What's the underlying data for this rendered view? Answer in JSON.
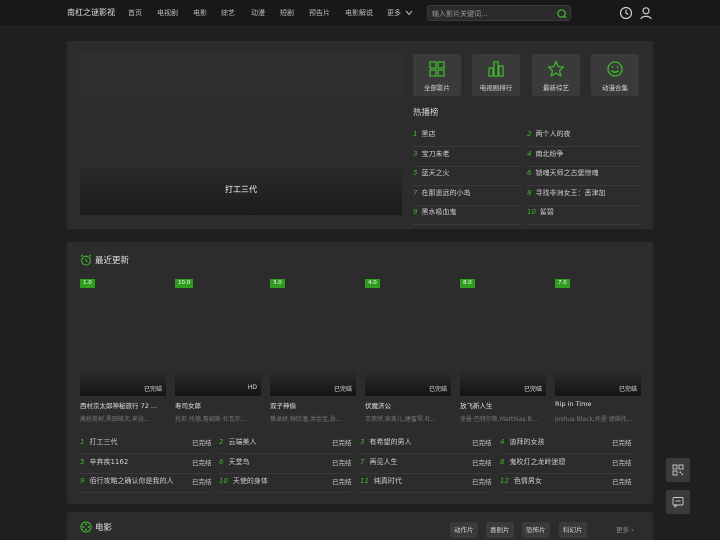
{
  "header": {
    "logo": "南杠之谜影视",
    "nav": [
      "首页",
      "电视剧",
      "电影",
      "综艺",
      "动漫",
      "短剧",
      "预告片",
      "电影解说",
      "更多"
    ],
    "search_placeholder": "输入影片关键词...",
    "icons": [
      "history-icon",
      "user-icon"
    ]
  },
  "hero": {
    "title": "打工三代",
    "categories": [
      {
        "label": "全部影片",
        "icon": "grid-icon"
      },
      {
        "label": "电视剧排行",
        "icon": "bar-chart-icon"
      },
      {
        "label": "最新综艺",
        "icon": "star-icon"
      },
      {
        "label": "动漫合集",
        "icon": "smile-icon"
      }
    ],
    "hot_title": "热播榜",
    "hot_list": [
      {
        "num": "1",
        "title": "黑店"
      },
      {
        "num": "2",
        "title": "两个人的夜"
      },
      {
        "num": "3",
        "title": "宝刀未老"
      },
      {
        "num": "4",
        "title": "南北纷争"
      },
      {
        "num": "5",
        "title": "蓝天之火"
      },
      {
        "num": "6",
        "title": "锁魂天师之古堡惊魂"
      },
      {
        "num": "7",
        "title": "在那遥远的小岛"
      },
      {
        "num": "8",
        "title": "寻找非洲女王：恶津加"
      },
      {
        "num": "9",
        "title": "黑水吸血鬼"
      },
      {
        "num": "10",
        "title": "鲨碧"
      }
    ]
  },
  "recent": {
    "title": "最近更新",
    "cards": [
      {
        "score": "1.0",
        "status": "已完结",
        "name": "西村京太郎神秘旅行 72 ...",
        "cast": "高桥英树,黑田绫次,来谷..."
      },
      {
        "score": "10.0",
        "status": "HD",
        "name": "寿司女郎",
        "cast": "托尼·托德,詹姆斯·杜瓦尔..."
      },
      {
        "score": "3.0",
        "status": "已完结",
        "name": "双子神偷",
        "cast": "蔡卓妍,钟欣潼,洪金宝,张..."
      },
      {
        "score": "4.0",
        "status": "已完结",
        "name": "伏魔济公",
        "cast": "王荣然,宋美儿,唐蜜琴,杜..."
      },
      {
        "score": "8.0",
        "status": "已完结",
        "name": "放飞新人生",
        "cast": "菲曼·巴特尔斯,Matthias B..."
      },
      {
        "score": "7.0",
        "status": "已完结",
        "name": "Rip in Time",
        "cast": "Joshua Black,托里·德维托..."
      }
    ],
    "list": [
      {
        "num": "1",
        "title": "打工三代",
        "status": "已完结"
      },
      {
        "num": "2",
        "title": "云端美人",
        "status": "已完结"
      },
      {
        "num": "3",
        "title": "有希望的男人",
        "status": "已完结"
      },
      {
        "num": "4",
        "title": "迪拜的女孩",
        "status": "已完结"
      },
      {
        "num": "5",
        "title": "辛弃疾1162",
        "status": "已完结"
      },
      {
        "num": "6",
        "title": "天堂鸟",
        "status": "已完结"
      },
      {
        "num": "7",
        "title": "再见人生",
        "status": "已完结"
      },
      {
        "num": "8",
        "title": "鬼吹灯之龙岭迷窟",
        "status": "已完结"
      },
      {
        "num": "9",
        "title": "佰行攻略之确认你是我的人",
        "status": "已完结"
      },
      {
        "num": "10",
        "title": "天使的身体",
        "status": "已完结"
      },
      {
        "num": "11",
        "title": "纯真时代",
        "status": "已完结"
      },
      {
        "num": "12",
        "title": "色情男女",
        "status": "已完结"
      }
    ]
  },
  "movies": {
    "title": "电影",
    "tags": [
      "动作片",
      "喜剧片",
      "恐怖片",
      "科幻片"
    ],
    "more": "更多"
  },
  "float": {
    "icons": [
      "qrcode-icon",
      "message-icon"
    ]
  },
  "colors": {
    "accent": "#3fb62c",
    "background": "#1f1f1f",
    "panel": "#2c2c2c"
  }
}
